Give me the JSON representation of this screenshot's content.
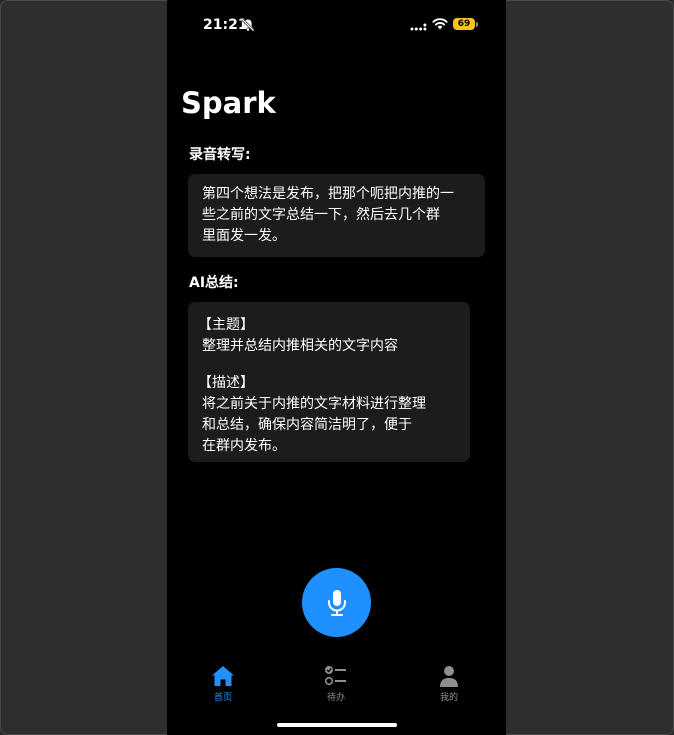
{
  "status_bar": {
    "time": "21:21",
    "battery": "69"
  },
  "app": {
    "title": "Spark"
  },
  "transcript": {
    "label": "录音转写:",
    "lines": [
      "第四个想法是发布，把那个呃把内推的一",
      "些之前的文字总结一下，然后去几个群",
      "里面发一发。"
    ]
  },
  "summary": {
    "label": "AI总结:",
    "topic_header": "【主题】",
    "topic_text": "整理并总结内推相关的文字内容",
    "desc_header": "【描述】",
    "desc_lines": [
      "将之前关于内推的文字材料进行整理",
      "和总结，确保内容简洁明了，便于",
      "在群内发布。"
    ]
  },
  "tabs": [
    {
      "label": "首页",
      "icon": "house-icon",
      "active": true
    },
    {
      "label": "待办",
      "icon": "checklist-icon",
      "active": false
    },
    {
      "label": "我的",
      "icon": "person-icon",
      "active": false
    }
  ],
  "colors": {
    "accent": "#1e90ff",
    "card": "#1c1c1e",
    "inactive": "#8e8e93",
    "battery": "#f5c518"
  }
}
